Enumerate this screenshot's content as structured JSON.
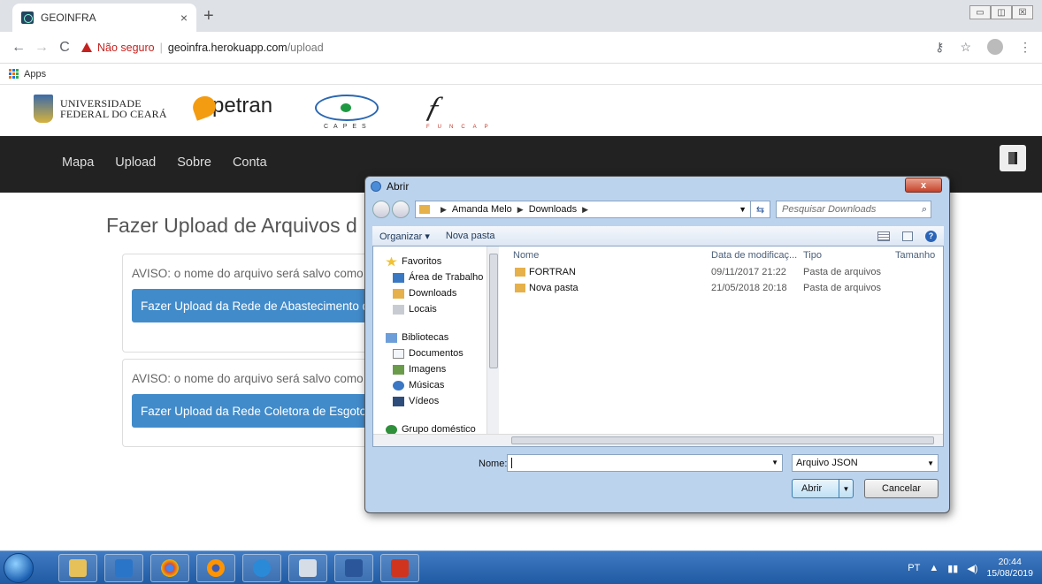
{
  "browser": {
    "tab_title": "GEOINFRA",
    "tab_close": "×",
    "new_tab": "+",
    "window_controls": [
      "▭",
      "◫",
      "☒"
    ],
    "insecure_label": "Não seguro",
    "separator": "|",
    "url_host": "geoinfra.herokuapp.com",
    "url_path": "/upload",
    "bookmarks_apps": "Apps"
  },
  "logos": {
    "ufc_line1": "UNIVERSIDADE",
    "ufc_line2": "FEDERAL DO CEARÁ",
    "petran": "petran",
    "capes": "CAPES",
    "funcap": "FUNCAP"
  },
  "navbar": {
    "items": [
      "Mapa",
      "Upload",
      "Sobre",
      "Conta"
    ]
  },
  "page": {
    "title": "Fazer Upload de Arquivos d",
    "panels": [
      {
        "aviso": "AVISO: o nome do arquivo será salvo como",
        "button": "Fazer Upload da Rede de Abastecimento d"
      },
      {
        "aviso": "AVISO: o nome do arquivo será salvo como",
        "button": "Fazer Upload da Rede Coletora de Esgoto"
      }
    ]
  },
  "dialog": {
    "title": "Abrir",
    "close_label": "x",
    "breadcrumb": [
      "Amanda Melo",
      "Downloads"
    ],
    "search_placeholder": "Pesquisar Downloads",
    "organize": "Organizar ▾",
    "new_folder": "Nova pasta",
    "nav_groups": [
      {
        "header": "Favoritos",
        "items": [
          "Área de Trabalho",
          "Downloads",
          "Locais"
        ]
      },
      {
        "header": "Bibliotecas",
        "items": [
          "Documentos",
          "Imagens",
          "Músicas",
          "Vídeos"
        ]
      },
      {
        "header": "Grupo doméstico",
        "items": []
      }
    ],
    "columns": [
      "Nome",
      "Data de modificaç...",
      "Tipo",
      "Tamanho"
    ],
    "files": [
      {
        "name": "FORTRAN",
        "modified": "09/11/2017 21:22",
        "type": "Pasta de arquivos"
      },
      {
        "name": "Nova pasta",
        "modified": "21/05/2018 20:18",
        "type": "Pasta de arquivos"
      }
    ],
    "name_label": "Nome:",
    "name_value": "",
    "file_type": "Arquivo JSON",
    "open_button": "Abrir",
    "cancel_button": "Cancelar"
  },
  "taskbar": {
    "language": "PT",
    "time": "20:44",
    "date": "15/08/2019"
  }
}
